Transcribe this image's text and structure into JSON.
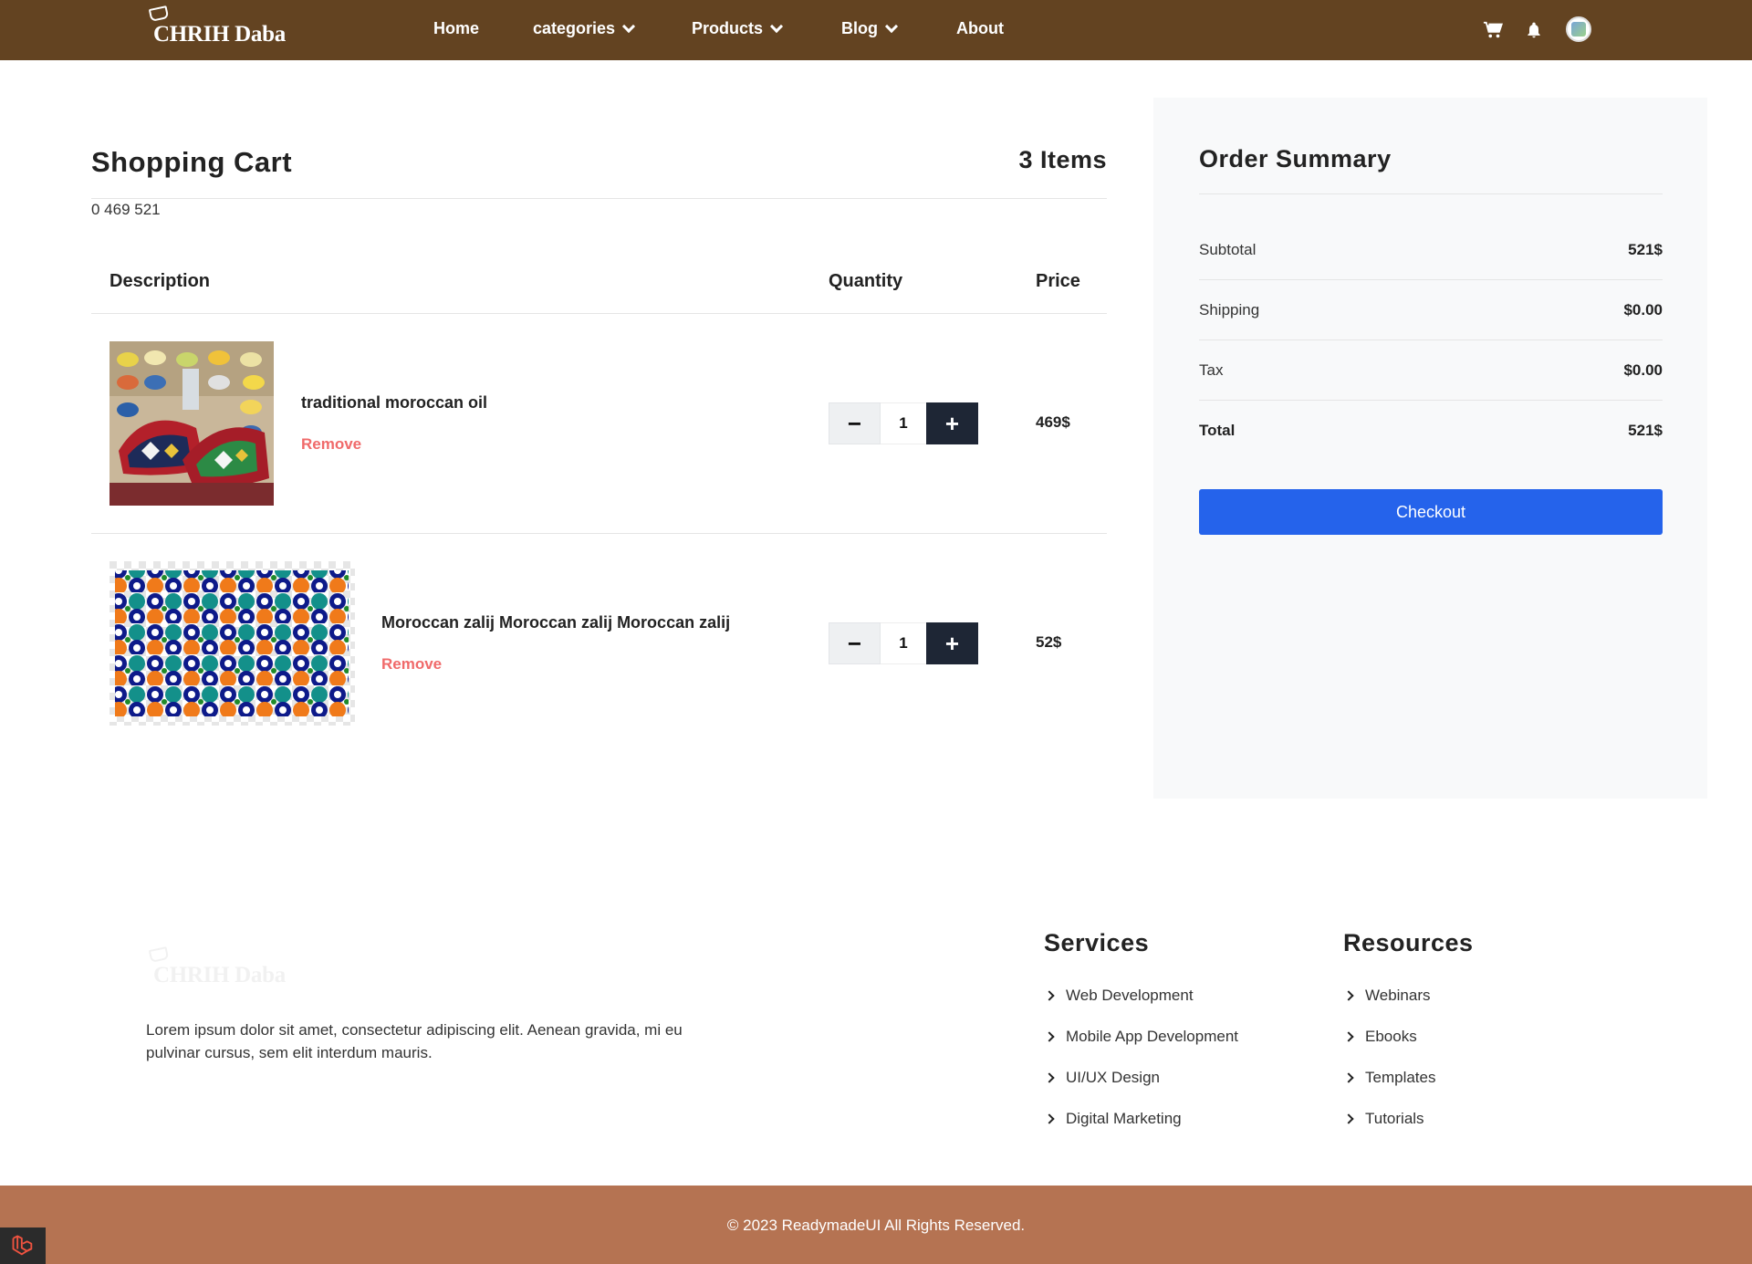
{
  "nav": {
    "brand": "CHRIH Daba",
    "links": [
      "Home",
      "categories",
      "Products",
      "Blog",
      "About"
    ],
    "icons": [
      "cart-icon",
      "bell-icon",
      "avatar"
    ]
  },
  "cart": {
    "title": "Shopping Cart",
    "item_count": "3 Items",
    "subline": "0 469 521",
    "columns": [
      "Description",
      "Quantity",
      "Price"
    ],
    "items": [
      {
        "name": "traditional moroccan oil",
        "remove": "Remove",
        "quantity": "1",
        "minus": "−",
        "plus": "+",
        "price": "469$"
      },
      {
        "name": "Moroccan zalij Moroccan zalij Moroccan zalij",
        "remove": "Remove",
        "quantity": "1",
        "minus": "−",
        "plus": "+",
        "price": "52$"
      }
    ]
  },
  "summary": {
    "title": "Order Summary",
    "rows": [
      {
        "label": "Subtotal",
        "value": "521$"
      },
      {
        "label": "Shipping",
        "value": "$0.00"
      },
      {
        "label": "Tax",
        "value": "$0.00"
      },
      {
        "label": "Total",
        "value": "521$"
      }
    ],
    "checkout": "Checkout",
    "accent": "#2563eb"
  },
  "footer": {
    "brand": "CHRIH Daba",
    "text": "Lorem ipsum dolor sit amet, consectetur adipiscing elit. Aenean gravida, mi eu pulvinar cursus, sem elit interdum mauris.",
    "services_title": "Services",
    "services": [
      "Web Development",
      "Mobile App Development",
      "UI/UX Design",
      "Digital Marketing"
    ],
    "resources_title": "Resources",
    "resources": [
      "Webinars",
      "Ebooks",
      "Templates",
      "Tutorials"
    ],
    "copyright": "© 2023 ReadymadeUI All Rights Reserved.",
    "bar_color": "#b57352"
  },
  "colors": {
    "nav": "#634321",
    "remove": "#f06a6a",
    "dark_button": "#1e2635"
  }
}
